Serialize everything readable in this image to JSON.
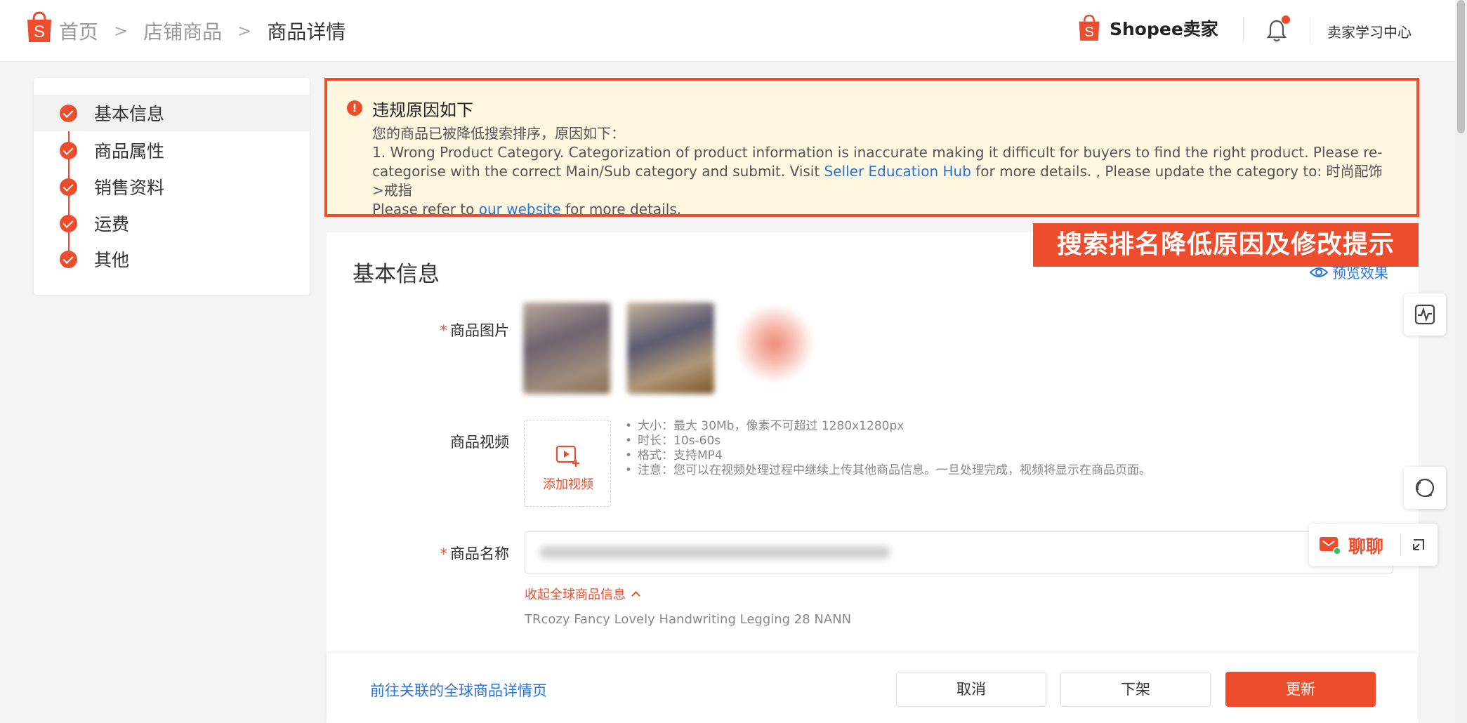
{
  "header": {
    "breadcrumbs": [
      "首页",
      "店铺商品",
      "商品详情"
    ],
    "brand": "Shopee卖家",
    "learning_center": "卖家学习中心",
    "has_notification": true
  },
  "sidebar": {
    "items": [
      {
        "label": "基本信息",
        "active": true
      },
      {
        "label": "商品属性",
        "active": false
      },
      {
        "label": "销售资料",
        "active": false
      },
      {
        "label": "运费",
        "active": false
      },
      {
        "label": "其他",
        "active": false
      }
    ]
  },
  "alert": {
    "title": "违规原因如下",
    "intro": "您的商品已被降低搜索排序，原因如下：",
    "reason_prefix": "1. Wrong Product Category. Categorization of product information is inaccurate making it difficult for buyers to find the right product. Please re-categorise with the correct Main/Sub category and submit. Visit ",
    "reason_link": "Seller Education Hub",
    "reason_suffix": " for more details. , Please update the category to: 时尚配饰>戒指",
    "refer_prefix": "Please refer to ",
    "refer_link": "our website",
    "refer_suffix": " for more details."
  },
  "annotation_tag": "搜索排名降低原因及修改提示",
  "main": {
    "section_title": "基本信息",
    "preview_label": "预览效果",
    "image_label": "商品图片",
    "video_label": "商品视频",
    "add_video": "添加视频",
    "video_rules": [
      "大小：最大 30Mb，像素不可超过 1280x1280px",
      "时长：10s-60s",
      "格式：支持MP4",
      "注意：您可以在视频处理过程中继续上传其他商品信息。一旦处理完成，视频将显示在商品页面。"
    ],
    "name_label": "商品名称",
    "collapse_global": "收起全球商品信息",
    "global_product_name": "TRcozy Fancy Lovely Handwriting Legging 28  NANN"
  },
  "footer": {
    "global_link": "前往关联的全球商品详情页",
    "cancel": "取消",
    "delist": "下架",
    "update": "更新"
  },
  "chat": {
    "label": "聊聊"
  },
  "colors": {
    "brand": "#ee4d2d",
    "link": "#2673dd",
    "alert_bg": "#fff7e0"
  }
}
